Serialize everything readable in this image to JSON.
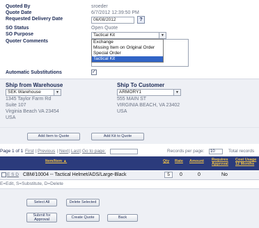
{
  "quote": {
    "quoted_by_label": "Quoted By",
    "quoted_by_value": "sroeder",
    "quote_date_label": "Quote Date",
    "quote_date_value": "6/7/2012 12:39:50 PM",
    "requested_delivery_label": "Requested Delivery Date",
    "requested_delivery_value": "06/08/2012",
    "so_status_label": "SO Status",
    "so_status_value": "Open Quote",
    "so_purpose_label": "SO Purpose",
    "so_purpose_selected": "Tactical Kit",
    "so_purpose_options": [
      "Exchange",
      "Missing Item on Original Order",
      "Special Order",
      "Tactical Kit"
    ],
    "quoter_comments_label": "Quoter Comments",
    "auto_subs_label": "Automatic Substitutions"
  },
  "ship_from": {
    "label": "Ship from Warehouse",
    "selected": "SEK Warehouse",
    "line1": "1345 Taylor Farm Rd",
    "line2": "Suite 107",
    "line3": "Virginia Beach VA 23454",
    "line4": "USA"
  },
  "ship_to": {
    "label": "Ship To Customer",
    "selected": "ARMORY1",
    "line1": "555 MAIN ST",
    "line2": "VIRGINIA BEACH, VA 23402",
    "line3": "USA"
  },
  "actions": {
    "add_item": "Add Item to Quote",
    "add_kit": "Add Kit to Quote"
  },
  "pager": {
    "summary": "Page 1 of 1",
    "first": "First",
    "previous": "Previous",
    "next": "Next",
    "last": "Last",
    "goto_label": "Go to page:",
    "records_label": "Records per page:",
    "records_value": "10",
    "total_label": "Total records"
  },
  "grid": {
    "headers": [
      "Item/Item ▲",
      "Qty",
      "Rate",
      "Amount",
      "Requires Approval",
      "Cost Usage 12 Months"
    ],
    "row": {
      "actions": "E S D",
      "item": "CBM/10004 -- Tactical Helmet/ADS/Large-Black",
      "qty": "5",
      "rate": "0",
      "amount": "0",
      "requires_approval": "No"
    },
    "legend": "E=Edit, S=Substitute, D=Delete"
  },
  "bottom_buttons": {
    "select_all": "Select All",
    "delete_selected": "Delete Selected",
    "submit_approval": "Submit for Approval",
    "create_quote": "Create Quote",
    "back": "Back"
  }
}
